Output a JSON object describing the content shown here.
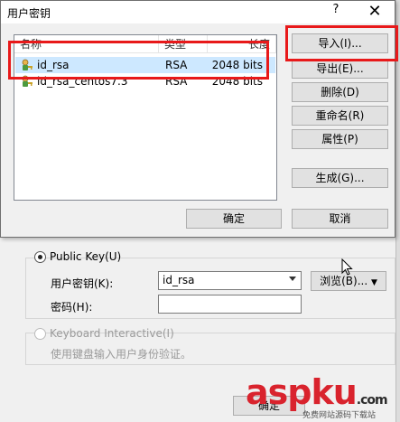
{
  "dialog": {
    "title": "用户密钥",
    "help_label": "?",
    "close_label": "✕",
    "columns": [
      "名称",
      "类型",
      "长度"
    ],
    "keys": [
      {
        "name": "id_rsa",
        "type": "RSA",
        "length": "2048 bits",
        "selected": true
      },
      {
        "name": "id_rsa_centos7.3",
        "type": "RSA",
        "length": "2048 bits",
        "selected": false
      }
    ],
    "buttons": {
      "import": "导入(I)...",
      "export": "导出(E)...",
      "delete": "删除(D)",
      "rename": "重命名(R)",
      "properties": "属性(P)",
      "generate": "生成(G)...",
      "ok": "确定",
      "cancel": "取消"
    }
  },
  "background": {
    "public_key_label": "Public Key(U)",
    "user_key_label": "用户密钥(K):",
    "user_key_value": "id_rsa",
    "password_label": "密码(H):",
    "password_value": "",
    "browse_label": "浏览(B)...",
    "keyboard_label": "Keyboard Interactive(I)",
    "keyboard_desc": "使用键盘输入用户身份验证。",
    "ok_label": "确定"
  },
  "watermark": {
    "main": "aspku",
    "com": ".com",
    "sub": "免费网站源码下载站"
  },
  "colors": {
    "highlight": "#e8191a",
    "selection": "#cde8ff",
    "watermark_red": "#d9232d",
    "watermark_dark": "#2b2b2b"
  }
}
